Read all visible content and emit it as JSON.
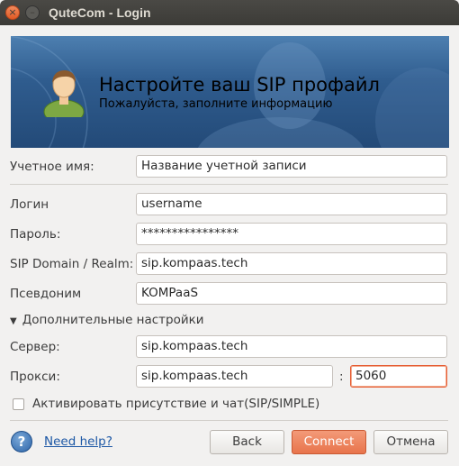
{
  "window": {
    "title": "QuteCom - Login",
    "close_glyph": "×",
    "min_glyph": "–"
  },
  "banner": {
    "title": "Настройте ваш SIP профайл",
    "subtitle": "Пожалуйста, заполните информацию",
    "icon": "user-avatar-icon"
  },
  "form": {
    "account_name_label": "Учетное имя:",
    "account_name_value": "Название учетной записи",
    "login_label": "Логин",
    "login_value": "username",
    "password_label": "Пароль:",
    "password_value": "****************",
    "domain_label": "SIP Domain / Realm:",
    "domain_value": "sip.kompaas.tech",
    "alias_label": "Псевдоним",
    "alias_value": "KOMPaaS",
    "advanced_toggle_label": "Дополнительные настройки",
    "server_label": "Сервер:",
    "server_value": "sip.kompaas.tech",
    "proxy_label": "Прокси:",
    "proxy_value": "sip.kompaas.tech",
    "port_separator": ":",
    "proxy_port_value": "5060",
    "presence_checkbox_label": "Активировать присутствие и чат(SIP/SIMPLE)",
    "presence_checked": false
  },
  "footer": {
    "help_icon_glyph": "?",
    "help_link": "Need help?",
    "back_label": "Back",
    "connect_label": "Connect",
    "cancel_label": "Отмена"
  },
  "colors": {
    "titlebar": "#3c3b37",
    "banner": "#2f5c8e",
    "accent": "#e8744c",
    "link": "#1c57a5"
  }
}
